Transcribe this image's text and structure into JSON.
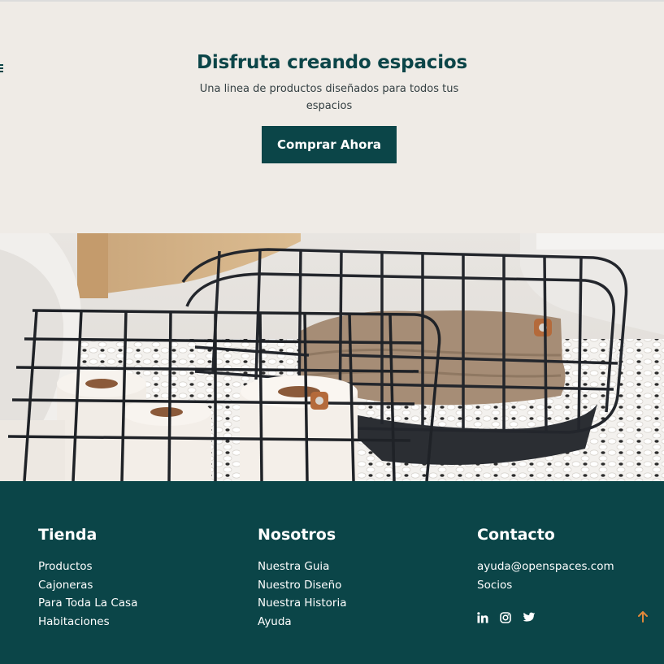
{
  "hero": {
    "title": "Disfruta creando espacios",
    "subtitle": "Una linea de productos diseñados para todos tus espacios",
    "cta_label": "Comprar Ahora"
  },
  "hero_image": {
    "alt": "wire-baskets-with-towels-and-toilet-paper"
  },
  "footer": {
    "columns": [
      {
        "title": "Tienda",
        "links": [
          "Productos",
          "Cajoneras",
          "Para Toda La Casa",
          "Habitaciones"
        ]
      },
      {
        "title": "Nosotros",
        "links": [
          "Nuestra Guia",
          "Nuestro Diseño",
          "Nuestra Historia",
          "Ayuda"
        ]
      },
      {
        "title": "Contacto",
        "links": [
          "ayuda@openspaces.com",
          "Socios"
        ]
      }
    ],
    "social_icons": [
      "linkedin-icon",
      "instagram-icon",
      "twitter-icon"
    ],
    "scroll_top_icon": "arrow-up-icon"
  },
  "colors": {
    "brand": "#0b4548",
    "hero_bg": "#efebe6",
    "accent_arrow": "#e0883a"
  }
}
